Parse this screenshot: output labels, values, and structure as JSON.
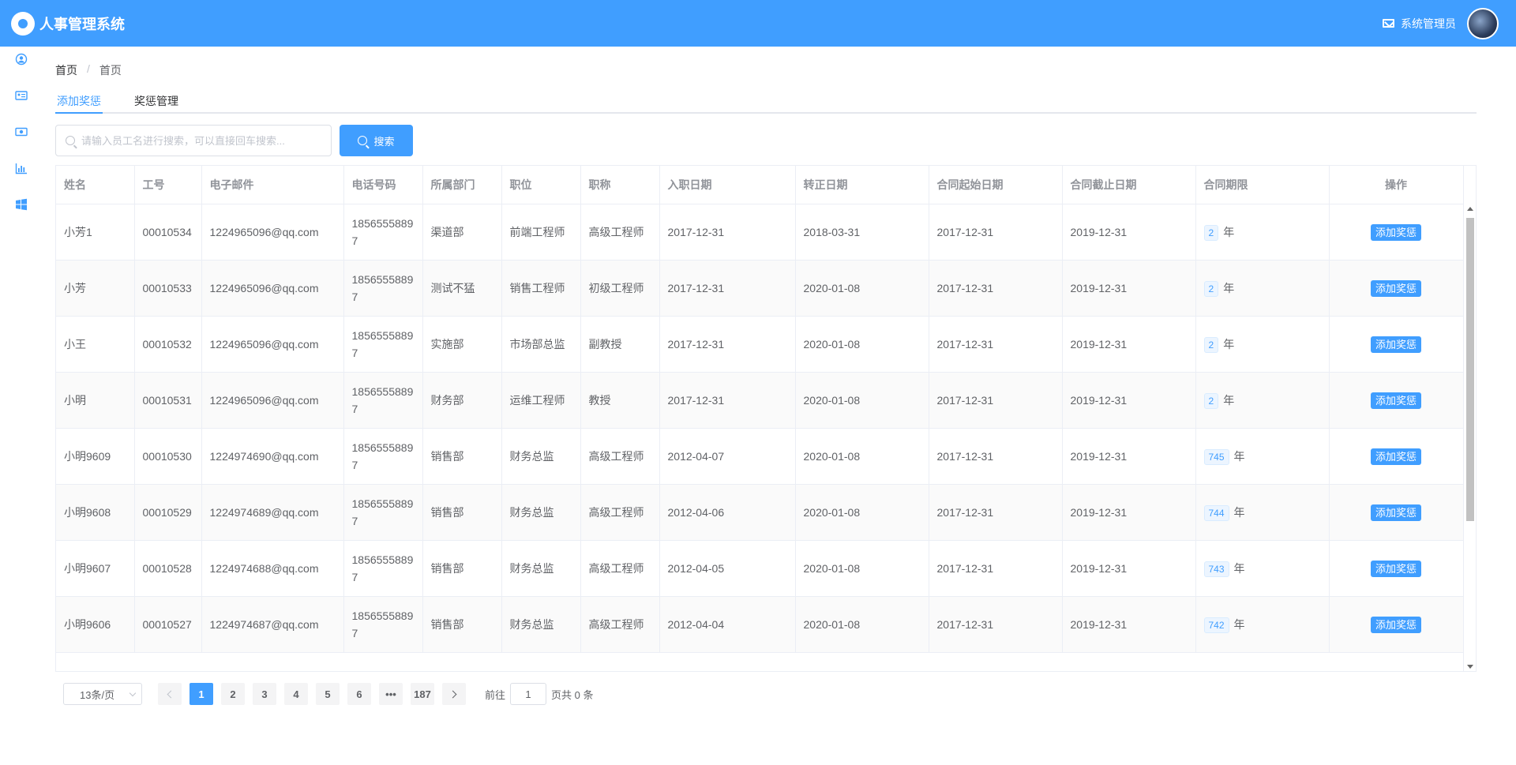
{
  "app": {
    "title": "人事管理系统"
  },
  "header": {
    "user_label": "系统管理员"
  },
  "sidebar": {
    "icons": [
      "user-icon",
      "id-card-icon",
      "eye-icon",
      "bar-chart-icon",
      "windows-icon"
    ]
  },
  "breadcrumb": {
    "root": "首页",
    "current": "首页"
  },
  "tabs": [
    {
      "label": "添加奖惩"
    },
    {
      "label": "奖惩管理"
    }
  ],
  "search": {
    "placeholder": "请输入员工名进行搜索，可以直接回车搜索...",
    "button": "搜索"
  },
  "table": {
    "headers": [
      "姓名",
      "工号",
      "电子邮件",
      "电话号码",
      "所属部门",
      "职位",
      "职称",
      "入职日期",
      "转正日期",
      "合同起始日期",
      "合同截止日期",
      "合同期限",
      "操作"
    ],
    "year_unit": "年",
    "op_label": "添加奖惩",
    "rows": [
      [
        "小芳1",
        "00010534",
        "1224965096@qq.com",
        "18565558897",
        "渠道部",
        "前端工程师",
        "高级工程师",
        "2017-12-31",
        "2018-03-31",
        "2017-12-31",
        "2019-12-31",
        "2"
      ],
      [
        "小芳",
        "00010533",
        "1224965096@qq.com",
        "18565558897",
        "测试不猛",
        "销售工程师",
        "初级工程师",
        "2017-12-31",
        "2020-01-08",
        "2017-12-31",
        "2019-12-31",
        "2"
      ],
      [
        "小王",
        "00010532",
        "1224965096@qq.com",
        "18565558897",
        "实施部",
        "市场部总监",
        "副教授",
        "2017-12-31",
        "2020-01-08",
        "2017-12-31",
        "2019-12-31",
        "2"
      ],
      [
        "小明",
        "00010531",
        "1224965096@qq.com",
        "18565558897",
        "财务部",
        "运维工程师",
        "教授",
        "2017-12-31",
        "2020-01-08",
        "2017-12-31",
        "2019-12-31",
        "2"
      ],
      [
        "小明9609",
        "00010530",
        "1224974690@qq.com",
        "18565558897",
        "销售部",
        "财务总监",
        "高级工程师",
        "2012-04-07",
        "2020-01-08",
        "2017-12-31",
        "2019-12-31",
        "745"
      ],
      [
        "小明9608",
        "00010529",
        "1224974689@qq.com",
        "18565558897",
        "销售部",
        "财务总监",
        "高级工程师",
        "2012-04-06",
        "2020-01-08",
        "2017-12-31",
        "2019-12-31",
        "744"
      ],
      [
        "小明9607",
        "00010528",
        "1224974688@qq.com",
        "18565558897",
        "销售部",
        "财务总监",
        "高级工程师",
        "2012-04-05",
        "2020-01-08",
        "2017-12-31",
        "2019-12-31",
        "743"
      ],
      [
        "小明9606",
        "00010527",
        "1224974687@qq.com",
        "18565558897",
        "销售部",
        "财务总监",
        "高级工程师",
        "2012-04-04",
        "2020-01-08",
        "2017-12-31",
        "2019-12-31",
        "742"
      ]
    ]
  },
  "pagination": {
    "page_size": "13条/页",
    "pages": [
      "1",
      "2",
      "3",
      "4",
      "5",
      "6",
      "•••",
      "187"
    ],
    "current": "1",
    "goto_label": "前往",
    "goto_value": "1",
    "total_label": "页共 0 条"
  },
  "colors": {
    "primary": "#409eff",
    "header_bg": "#409eff",
    "stripe": "#fafafa",
    "border": "#ebeef5"
  }
}
